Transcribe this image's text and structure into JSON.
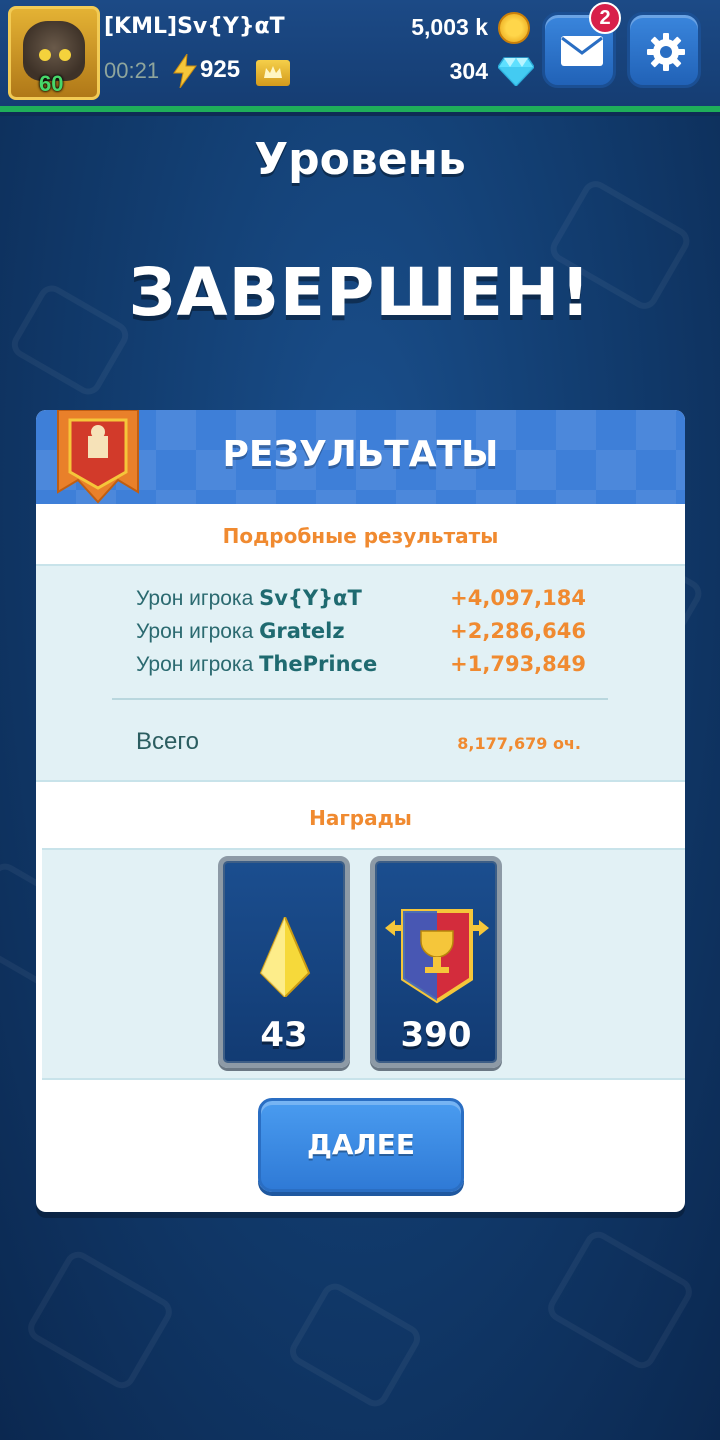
{
  "player": {
    "name": "[KML]Sv{Y}αT",
    "level": "60",
    "timer": "00:21",
    "energy": "925"
  },
  "currency": {
    "gold": "5,003 k",
    "gems": "304"
  },
  "mail": {
    "unread_count": "2"
  },
  "headline": {
    "line1": "Уровень",
    "line2": "ЗАВЕРШЕН!"
  },
  "results": {
    "title": "РЕЗУЛЬТАТЫ",
    "details_title": "Подробные результаты",
    "damage_prefix": "Урон игрока",
    "rows": [
      {
        "player": "Sv{Y}αT",
        "value": "+4,097,184"
      },
      {
        "player": "Gratelz",
        "value": "+2,286,646"
      },
      {
        "player": "ThePrince",
        "value": "+1,793,849"
      }
    ],
    "total_label": "Всего",
    "total_value": "8,177,679 оч.",
    "rewards_title": "Награды",
    "rewards": [
      {
        "icon": "crystal-icon",
        "value": "43"
      },
      {
        "icon": "trophy-banner-icon",
        "value": "390"
      }
    ],
    "next_label": "ДАЛЕЕ"
  },
  "colors": {
    "accent_orange": "#f08a30",
    "panel_blue": "#3e7fd8",
    "stats_bg": "#e2f1f5"
  }
}
